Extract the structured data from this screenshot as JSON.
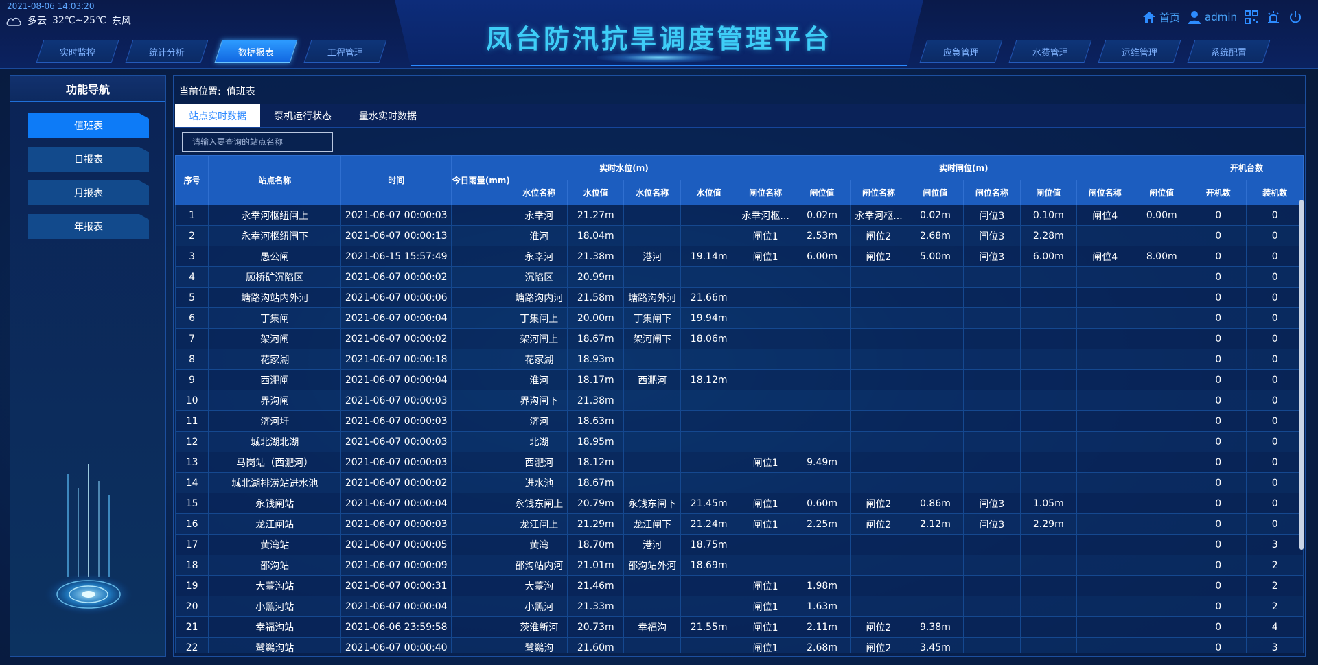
{
  "header": {
    "datetime": "2021-08-06 14:03:20",
    "weather": {
      "condition": "多云",
      "temperature": "32℃~25℃",
      "wind": "东风",
      "icon": "cloud-icon"
    },
    "title": "凤台防汛抗旱调度管理平台",
    "nav_left": [
      {
        "label": "实时监控",
        "active": false
      },
      {
        "label": "统计分析",
        "active": false
      },
      {
        "label": "数据报表",
        "active": true
      },
      {
        "label": "工程管理",
        "active": false
      }
    ],
    "nav_right": [
      {
        "label": "应急管理"
      },
      {
        "label": "水费管理"
      },
      {
        "label": "运维管理"
      },
      {
        "label": "系统配置"
      }
    ],
    "tools": {
      "home_label": "首页",
      "user_label": "admin"
    }
  },
  "sidebar": {
    "title": "功能导航",
    "items": [
      {
        "label": "值班表",
        "active": true
      },
      {
        "label": "日报表",
        "active": false
      },
      {
        "label": "月报表",
        "active": false
      },
      {
        "label": "年报表",
        "active": false
      }
    ]
  },
  "main": {
    "breadcrumb_label": "当前位置:",
    "breadcrumb_value": "值班表",
    "tabs": [
      {
        "label": "站点实时数据",
        "active": true
      },
      {
        "label": "泵机运行状态",
        "active": false
      },
      {
        "label": "量水实时数据",
        "active": false
      }
    ],
    "search_placeholder": "请输入要查询的站点名称",
    "table": {
      "headers": {
        "seq": "序号",
        "station": "站点名称",
        "time": "时间",
        "rain": "今日雨量(mm)",
        "water_group": "实时水位(m)",
        "gate_group": "实时闸位(m)",
        "machine_group": "开机台数",
        "water_sub": [
          "水位名称",
          "水位值",
          "水位名称",
          "水位值"
        ],
        "gate_sub": [
          "闸位名称",
          "闸位值",
          "闸位名称",
          "闸位值",
          "闸位名称",
          "闸位值",
          "闸位名称",
          "闸位值"
        ],
        "machine_sub": [
          "开机数",
          "装机数"
        ]
      },
      "rows": [
        [
          "1",
          "永幸河枢纽闸上",
          "2021-06-07 00:00:03",
          "",
          "永幸河",
          "21.27m",
          "",
          "",
          "永幸河枢...",
          "0.02m",
          "永幸河枢...",
          "0.02m",
          "闸位3",
          "0.10m",
          "闸位4",
          "0.00m",
          "0",
          "0"
        ],
        [
          "2",
          "永幸河枢纽闸下",
          "2021-06-07 00:00:13",
          "",
          "淮河",
          "18.04m",
          "",
          "",
          "闸位1",
          "2.53m",
          "闸位2",
          "2.68m",
          "闸位3",
          "2.28m",
          "",
          "",
          "0",
          "0"
        ],
        [
          "3",
          "愚公闸",
          "2021-06-15 15:57:49",
          "",
          "永幸河",
          "21.38m",
          "港河",
          "19.14m",
          "闸位1",
          "6.00m",
          "闸位2",
          "5.00m",
          "闸位3",
          "6.00m",
          "闸位4",
          "8.00m",
          "0",
          "0"
        ],
        [
          "4",
          "顾桥矿沉陷区",
          "2021-06-07 00:00:02",
          "",
          "沉陷区",
          "20.99m",
          "",
          "",
          "",
          "",
          "",
          "",
          "",
          "",
          "",
          "",
          "0",
          "0"
        ],
        [
          "5",
          "塘路沟站内外河",
          "2021-06-07 00:00:06",
          "",
          "塘路沟内河",
          "21.58m",
          "塘路沟外河",
          "21.66m",
          "",
          "",
          "",
          "",
          "",
          "",
          "",
          "",
          "0",
          "0"
        ],
        [
          "6",
          "丁集闸",
          "2021-06-07 00:00:04",
          "",
          "丁集闸上",
          "20.00m",
          "丁集闸下",
          "19.94m",
          "",
          "",
          "",
          "",
          "",
          "",
          "",
          "",
          "0",
          "0"
        ],
        [
          "7",
          "架河闸",
          "2021-06-07 00:00:02",
          "",
          "架河闸上",
          "18.67m",
          "架河闸下",
          "18.06m",
          "",
          "",
          "",
          "",
          "",
          "",
          "",
          "",
          "0",
          "0"
        ],
        [
          "8",
          "花家湖",
          "2021-06-07 00:00:18",
          "",
          "花家湖",
          "18.93m",
          "",
          "",
          "",
          "",
          "",
          "",
          "",
          "",
          "",
          "",
          "0",
          "0"
        ],
        [
          "9",
          "西淝闸",
          "2021-06-07 00:00:04",
          "",
          "淮河",
          "18.17m",
          "西淝河",
          "18.12m",
          "",
          "",
          "",
          "",
          "",
          "",
          "",
          "",
          "0",
          "0"
        ],
        [
          "10",
          "界沟闸",
          "2021-06-07 00:00:03",
          "",
          "界沟闸下",
          "21.38m",
          "",
          "",
          "",
          "",
          "",
          "",
          "",
          "",
          "",
          "",
          "0",
          "0"
        ],
        [
          "11",
          "济河圩",
          "2021-06-07 00:00:03",
          "",
          "济河",
          "18.63m",
          "",
          "",
          "",
          "",
          "",
          "",
          "",
          "",
          "",
          "",
          "0",
          "0"
        ],
        [
          "12",
          "城北湖北湖",
          "2021-06-07 00:00:03",
          "",
          "北湖",
          "18.95m",
          "",
          "",
          "",
          "",
          "",
          "",
          "",
          "",
          "",
          "",
          "0",
          "0"
        ],
        [
          "13",
          "马岗站（西淝河）",
          "2021-06-07 00:00:03",
          "",
          "西淝河",
          "18.12m",
          "",
          "",
          "闸位1",
          "9.49m",
          "",
          "",
          "",
          "",
          "",
          "",
          "0",
          "0"
        ],
        [
          "14",
          "城北湖排涝站进水池",
          "2021-06-07 00:00:02",
          "",
          "进水池",
          "18.67m",
          "",
          "",
          "",
          "",
          "",
          "",
          "",
          "",
          "",
          "",
          "0",
          "0"
        ],
        [
          "15",
          "永钱闸站",
          "2021-06-07 00:00:04",
          "",
          "永钱东闸上",
          "20.79m",
          "永钱东闸下",
          "21.45m",
          "闸位1",
          "0.60m",
          "闸位2",
          "0.86m",
          "闸位3",
          "1.05m",
          "",
          "",
          "0",
          "0"
        ],
        [
          "16",
          "龙江闸站",
          "2021-06-07 00:00:03",
          "",
          "龙江闸上",
          "21.29m",
          "龙江闸下",
          "21.24m",
          "闸位1",
          "2.25m",
          "闸位2",
          "2.12m",
          "闸位3",
          "2.29m",
          "",
          "",
          "0",
          "0"
        ],
        [
          "17",
          "黄湾站",
          "2021-06-07 00:00:05",
          "",
          "黄湾",
          "18.70m",
          "港河",
          "18.75m",
          "",
          "",
          "",
          "",
          "",
          "",
          "",
          "",
          "0",
          "3"
        ],
        [
          "18",
          "邵沟站",
          "2021-06-07 00:00:09",
          "",
          "邵沟站内河",
          "21.01m",
          "邵沟站外河",
          "18.69m",
          "",
          "",
          "",
          "",
          "",
          "",
          "",
          "",
          "0",
          "2"
        ],
        [
          "19",
          "大薹沟站",
          "2021-06-07 00:00:31",
          "",
          "大薹沟",
          "21.46m",
          "",
          "",
          "闸位1",
          "1.98m",
          "",
          "",
          "",
          "",
          "",
          "",
          "0",
          "2"
        ],
        [
          "20",
          "小黑河站",
          "2021-06-07 00:00:04",
          "",
          "小黑河",
          "21.33m",
          "",
          "",
          "闸位1",
          "1.63m",
          "",
          "",
          "",
          "",
          "",
          "",
          "0",
          "2"
        ],
        [
          "21",
          "幸福沟站",
          "2021-06-06 23:59:58",
          "",
          "茨淮新河",
          "20.73m",
          "幸福沟",
          "21.55m",
          "闸位1",
          "2.11m",
          "闸位2",
          "9.38m",
          "",
          "",
          "",
          "",
          "0",
          "4"
        ],
        [
          "22",
          "鹭鹚沟站",
          "2021-06-07 00:00:40",
          "",
          "鹭鹚沟",
          "21.60m",
          "",
          "",
          "闸位1",
          "2.68m",
          "闸位2",
          "3.45m",
          "",
          "",
          "",
          "",
          "0",
          "3"
        ]
      ]
    }
  }
}
